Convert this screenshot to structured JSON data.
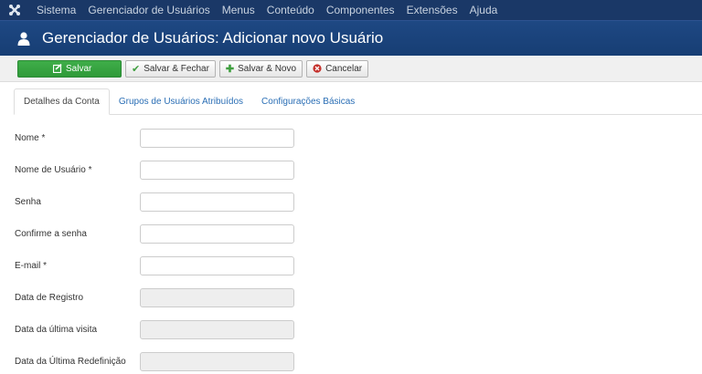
{
  "navbar": {
    "logo_icon": "joomla-logo-icon",
    "items": [
      {
        "label": "Sistema"
      },
      {
        "label": "Gerenciador de Usuários"
      },
      {
        "label": "Menus"
      },
      {
        "label": "Conteúdo"
      },
      {
        "label": "Componentes"
      },
      {
        "label": "Extensões"
      },
      {
        "label": "Ajuda"
      }
    ]
  },
  "header": {
    "icon": "user-icon",
    "title": "Gerenciador de Usuários: Adicionar novo Usuário"
  },
  "toolbar": {
    "save_label": "Salvar",
    "save_close_label": "Salvar & Fechar",
    "save_new_label": "Salvar & Novo",
    "cancel_label": "Cancelar"
  },
  "tabs": [
    {
      "label": "Detalhes da Conta",
      "active": true
    },
    {
      "label": "Grupos de Usuários Atribuídos",
      "active": false
    },
    {
      "label": "Configurações Básicas",
      "active": false
    }
  ],
  "form": {
    "fields": [
      {
        "label": "Nome",
        "required": true,
        "value": "",
        "readonly": false
      },
      {
        "label": "Nome de Usuário",
        "required": true,
        "value": "",
        "readonly": false
      },
      {
        "label": "Senha",
        "required": false,
        "value": "",
        "readonly": false
      },
      {
        "label": "Confirme a senha",
        "required": false,
        "value": "",
        "readonly": false
      },
      {
        "label": "E-mail",
        "required": true,
        "value": "",
        "readonly": false
      },
      {
        "label": "Data de Registro",
        "required": false,
        "value": "",
        "readonly": true
      },
      {
        "label": "Data da última visita",
        "required": false,
        "value": "",
        "readonly": true
      },
      {
        "label": "Data da Última Redefinição",
        "required": false,
        "value": "",
        "readonly": true
      }
    ]
  },
  "colors": {
    "navbar_bg": "#1a3867",
    "header_bg": "#1e4883",
    "save_green": "#3fae49",
    "link_blue": "#2a6eb5",
    "cancel_red": "#c4302b"
  }
}
